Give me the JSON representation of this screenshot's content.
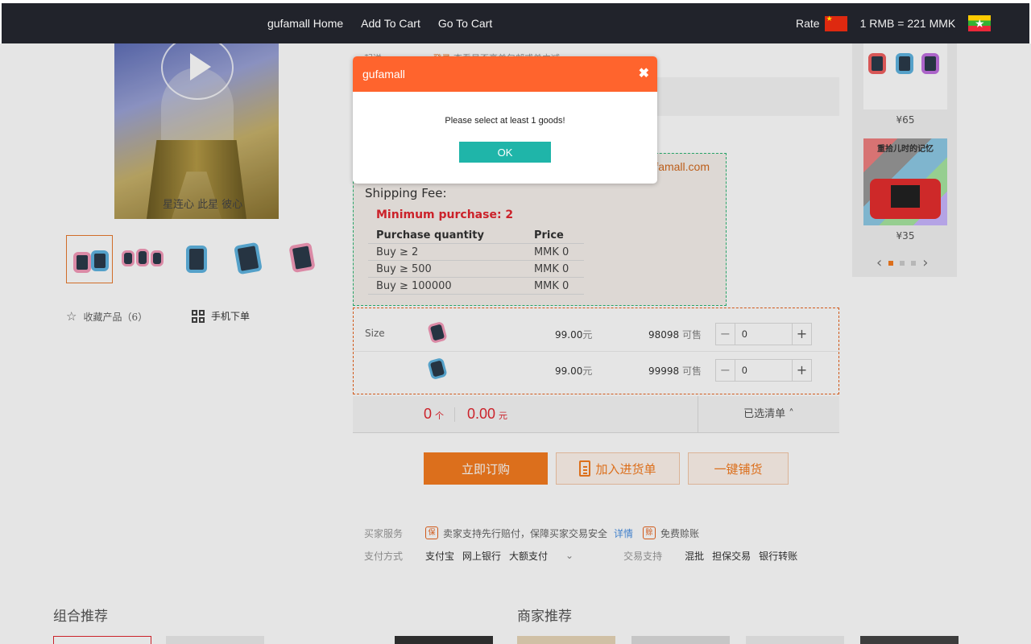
{
  "topnav": {
    "links": [
      "gufamall Home",
      "Add To Cart",
      "Go To Cart"
    ],
    "rate_label": "Rate",
    "rate_value": "1 RMB = 221 MMK",
    "flags": [
      "china-flag",
      "myanmar-flag"
    ]
  },
  "gallery": {
    "main_caption": "星连心 此星 彼心",
    "thumbnail_count": 5,
    "active_thumbnail": 1,
    "favorite_label": "收藏产品（6）",
    "mobile_order_label": "手机下单"
  },
  "product": {
    "top_line_label": "起送",
    "top_line_login": "登录",
    "top_line_text": "查看是否享单包邮或单立减",
    "email_fragment": "famall.com",
    "shipping_fee_label": "Shipping Fee:",
    "minimum_purchase": "Minimum purchase: 2",
    "tier_headers": [
      "Purchase quantity",
      "Price"
    ],
    "tiers": [
      {
        "qty": "Buy ≥ 2",
        "price": "MMK 0"
      },
      {
        "qty": "Buy ≥ 500",
        "price": "MMK 0"
      },
      {
        "qty": "Buy ≥ 100000",
        "price": "MMK 0"
      }
    ]
  },
  "skus": {
    "label": "Size",
    "rows": [
      {
        "color": "pink",
        "price": "99.00",
        "currency": "元",
        "stock": "98098",
        "stock_suffix": "可售",
        "qty": "0"
      },
      {
        "color": "blue",
        "price": "99.00",
        "currency": "元",
        "stock": "99998",
        "stock_suffix": "可售",
        "qty": "0"
      }
    ],
    "minus": "−",
    "plus": "+"
  },
  "summary": {
    "count": "0",
    "count_unit": "个",
    "amount": "0.00",
    "amount_unit": "元",
    "selected_list": "已选清单 ˄"
  },
  "actions": {
    "buy_now": "立即订购",
    "add_to_list": "加入进货单",
    "one_click": "一键铺货"
  },
  "services": {
    "buyer_service_label": "买家服务",
    "guarantee_badge": "保",
    "guarantee_text": "卖家支持先行赔付，保障买家交易安全",
    "details_link": "详情",
    "credit_badge": "赊",
    "credit_text": "免费赊账",
    "payment_label": "支付方式",
    "payment_methods": [
      "支付宝",
      "网上银行",
      "大额支付"
    ],
    "trade_support_label": "交易支持",
    "trade_support": [
      "混批",
      "担保交易",
      "银行转账"
    ]
  },
  "side_recommend": {
    "items": [
      {
        "price": "¥65"
      },
      {
        "price": "¥35",
        "title": "重拾儿时的记忆"
      }
    ],
    "pages": 3,
    "current_page": 1
  },
  "bottom": {
    "combo_title": "组合推荐",
    "merchant_title": "商家推荐"
  },
  "dialog": {
    "title": "gufamall",
    "message": "Please select at least 1 goods!",
    "ok_label": "OK",
    "close_glyph": "✖"
  }
}
